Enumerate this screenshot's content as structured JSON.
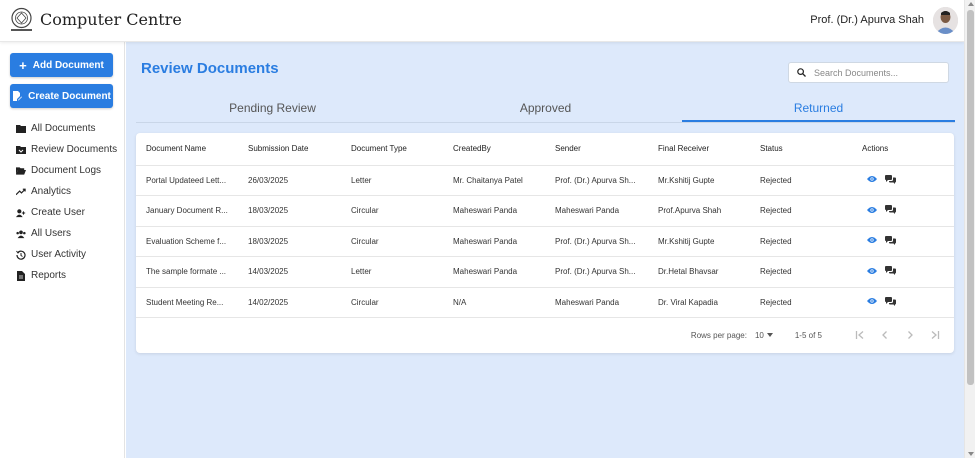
{
  "header": {
    "brand": "Computer Centre",
    "user_name": "Prof. (Dr.) Apurva Shah"
  },
  "sidebar": {
    "add_document": "Add Document",
    "create_document": "Create Document",
    "items": [
      {
        "label": "All Documents",
        "icon": "folder-icon"
      },
      {
        "label": "Review Documents",
        "icon": "folder-review-icon"
      },
      {
        "label": "Document Logs",
        "icon": "folder-open-icon"
      },
      {
        "label": "Analytics",
        "icon": "trending-up-icon"
      },
      {
        "label": "Create User",
        "icon": "user-plus-icon"
      },
      {
        "label": "All Users",
        "icon": "users-icon"
      },
      {
        "label": "User Activity",
        "icon": "history-icon"
      },
      {
        "label": "Reports",
        "icon": "file-icon"
      }
    ]
  },
  "main": {
    "title": "Review Documents",
    "search_placeholder": "Search Documents...",
    "tabs": [
      "Pending Review",
      "Approved",
      "Returned"
    ],
    "active_tab": 2,
    "columns": [
      "Document Name",
      "Submission Date",
      "Document Type",
      "CreatedBy",
      "Sender",
      "Final Receiver",
      "Status",
      "Actions"
    ],
    "rows": [
      [
        "Portal Updateed Lett...",
        "26/03/2025",
        "Letter",
        "Mr. Chaitanya Patel",
        "Prof. (Dr.) Apurva Sh...",
        "Mr.Kshitij Gupte",
        "Rejected"
      ],
      [
        "January Document R...",
        "18/03/2025",
        "Circular",
        "Maheswari Panda",
        "Maheswari Panda",
        "Prof.Apurva Shah",
        "Rejected"
      ],
      [
        "Evaluation Scheme f...",
        "18/03/2025",
        "Circular",
        "Maheswari Panda",
        "Prof. (Dr.) Apurva Sh...",
        "Mr.Kshitij Gupte",
        "Rejected"
      ],
      [
        "The sample formate ...",
        "14/03/2025",
        "Letter",
        "Maheswari Panda",
        "Prof. (Dr.) Apurva Sh...",
        "Dr.Hetal Bhavsar",
        "Rejected"
      ],
      [
        "Student Meeting Re...",
        "14/02/2025",
        "Circular",
        "N/A",
        "Maheswari Panda",
        "Dr. Viral Kapadia",
        "Rejected"
      ]
    ],
    "pagination": {
      "rows_per_page_label": "Rows per page:",
      "rows_per_page": "10",
      "range": "1-5 of 5"
    }
  },
  "colors": {
    "accent": "#2a7de1",
    "main_bg": "#dde9fb"
  }
}
